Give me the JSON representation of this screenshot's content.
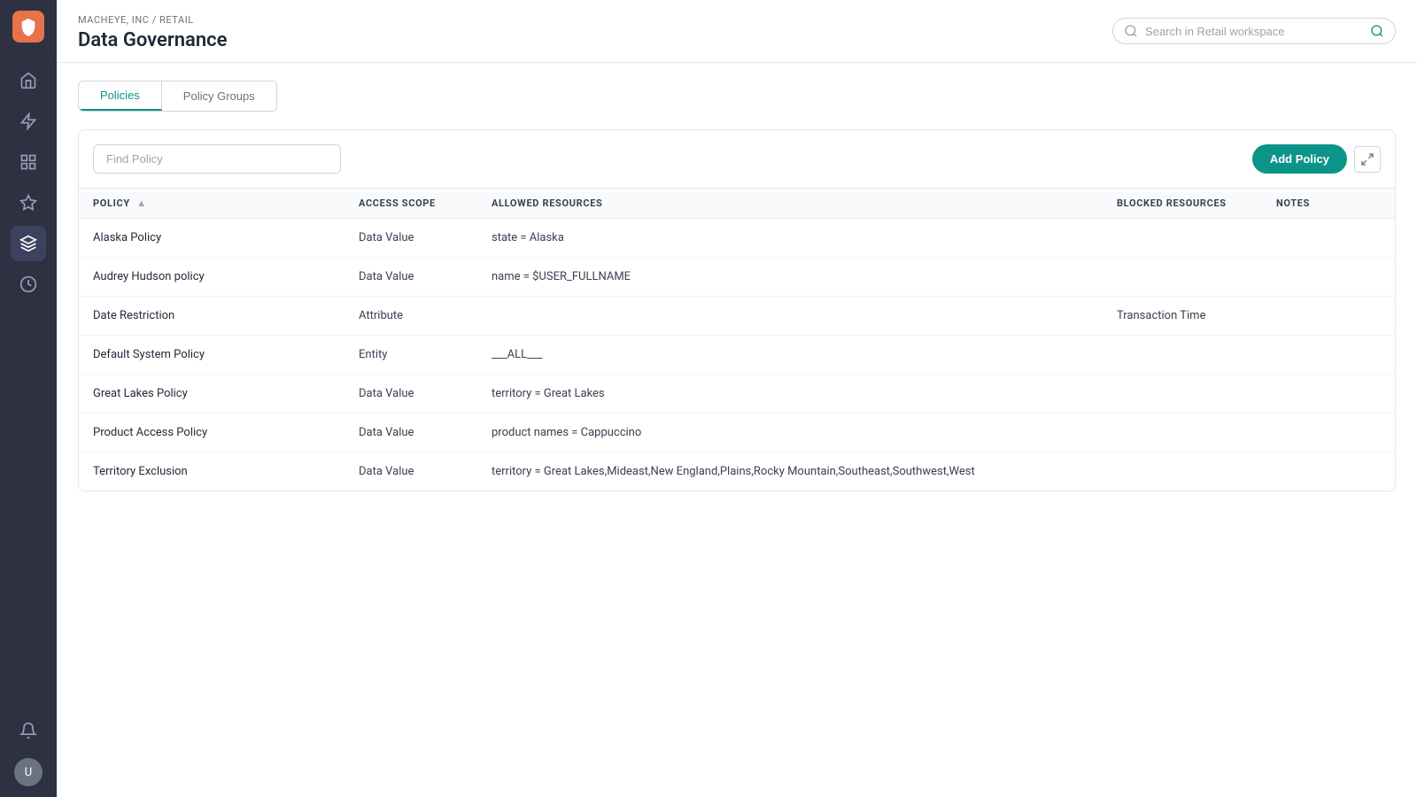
{
  "app": {
    "logo_label": "App Logo"
  },
  "sidebar": {
    "items": [
      {
        "name": "home-icon",
        "label": "Home",
        "active": false
      },
      {
        "name": "lightning-icon",
        "label": "Events",
        "active": false
      },
      {
        "name": "grid-icon",
        "label": "Grid",
        "active": false
      },
      {
        "name": "star-icon",
        "label": "Favorites",
        "active": false
      },
      {
        "name": "layers-icon",
        "label": "Layers",
        "active": true
      },
      {
        "name": "clock-icon",
        "label": "History",
        "active": false
      }
    ]
  },
  "header": {
    "breadcrumb": "MACHEYE, INC / RETAIL",
    "title": "Data Governance",
    "search_placeholder": "Search in Retail workspace"
  },
  "tabs": [
    {
      "id": "policies",
      "label": "Policies",
      "active": true
    },
    {
      "id": "policy-groups",
      "label": "Policy Groups",
      "active": false
    }
  ],
  "toolbar": {
    "find_placeholder": "Find Policy",
    "add_button_label": "Add Policy"
  },
  "table": {
    "columns": [
      {
        "key": "policy",
        "label": "POLICY",
        "sortable": true
      },
      {
        "key": "access_scope",
        "label": "ACCESS SCOPE",
        "sortable": false
      },
      {
        "key": "allowed_resources",
        "label": "ALLOWED RESOURCES",
        "sortable": false
      },
      {
        "key": "blocked_resources",
        "label": "BLOCKED RESOURCES",
        "sortable": false
      },
      {
        "key": "notes",
        "label": "NOTES",
        "sortable": false
      }
    ],
    "rows": [
      {
        "policy": "Alaska Policy",
        "access_scope": "Data Value",
        "allowed_resources": "state = Alaska",
        "blocked_resources": "",
        "notes": ""
      },
      {
        "policy": "Audrey Hudson policy",
        "access_scope": "Data Value",
        "allowed_resources": "name = $USER_FULLNAME",
        "blocked_resources": "",
        "notes": ""
      },
      {
        "policy": "Date Restriction",
        "access_scope": "Attribute",
        "allowed_resources": "",
        "blocked_resources": "Transaction Time",
        "notes": ""
      },
      {
        "policy": "Default System Policy",
        "access_scope": "Entity",
        "allowed_resources": "___ALL___",
        "blocked_resources": "",
        "notes": ""
      },
      {
        "policy": "Great Lakes Policy",
        "access_scope": "Data Value",
        "allowed_resources": "territory = Great Lakes",
        "blocked_resources": "",
        "notes": ""
      },
      {
        "policy": "Product Access Policy",
        "access_scope": "Data Value",
        "allowed_resources": "product names = Cappuccino",
        "blocked_resources": "",
        "notes": ""
      },
      {
        "policy": "Territory Exclusion",
        "access_scope": "Data Value",
        "allowed_resources": "territory = Great Lakes,Mideast,New England,Plains,Rocky Mountain,Southeast,Southwest,West",
        "blocked_resources": "",
        "notes": ""
      }
    ]
  },
  "colors": {
    "teal": "#0d9488",
    "sidebar_bg": "#2d3142",
    "accent_orange": "#e8724a"
  }
}
